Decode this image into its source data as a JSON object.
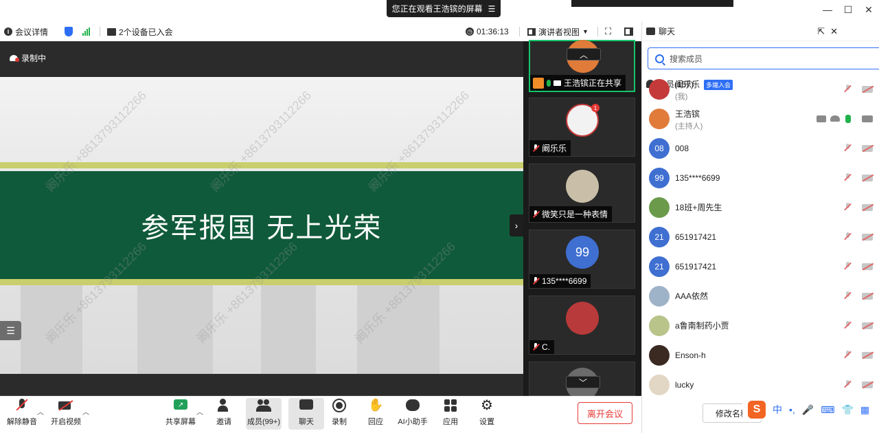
{
  "titlebar": {
    "share_notice": "您正在观看王浩镔的屏幕",
    "share_menu_icon": "menu-icon",
    "window_controls": [
      "—",
      "☐",
      "✕"
    ]
  },
  "infobar": {
    "meeting_info": "会议详情",
    "devices": "2个设备已入会",
    "duration": "01:36:13",
    "view_mode": "演讲者视图"
  },
  "stage": {
    "recording_label": "录制中",
    "slide_title": "参军报国  无上光荣",
    "watermarks": [
      "阚乐乐 +8613793112266",
      "阚乐乐 +8613793112266",
      "阚乐乐 +8613793112266",
      "阚乐乐 +8613793112266",
      "阚乐乐 +8613793112266",
      "阚乐乐 +8613793112266"
    ],
    "next_arrow": "›",
    "list_icon": "☰"
  },
  "thumbnails": [
    {
      "name": "王浩镔正在共享",
      "avatar_color": "#e07b3a",
      "active": true
    },
    {
      "name": "阚乐乐",
      "avatar_color": "#f2f2f2",
      "badge": "1"
    },
    {
      "name": "微笑只是一种表情",
      "avatar_color": "#c9bfa8"
    },
    {
      "name": "135****6699",
      "avatar_text": "99",
      "avatar_color": "#3f6fd1"
    },
    {
      "name": "C.",
      "avatar_color": "#b93a3a"
    },
    {
      "name": "",
      "avatar_color": "#6b6b6b"
    }
  ],
  "panel": {
    "tab_chat": "聊天",
    "tab_members": "成员(157)",
    "search_placeholder": "搜索成员",
    "members": [
      {
        "name": "阚乐乐",
        "sub": "(我)",
        "badge": "多端入会",
        "avatar_color": "#c43a3a",
        "mic": "off",
        "cam": "off"
      },
      {
        "name": "王浩镔",
        "sub": "(主持人)",
        "avatar_color": "#e07b3a",
        "mic": "on",
        "cam": "on",
        "extra": true
      },
      {
        "name": "008",
        "avatar_text": "08",
        "avatar_color": "#3f6fd1",
        "mic": "off",
        "cam": "off"
      },
      {
        "name": "135****6699",
        "avatar_text": "99",
        "avatar_color": "#3f6fd1",
        "mic": "off",
        "cam": "off"
      },
      {
        "name": "18班+周先生",
        "avatar_color": "#6b9b4a",
        "mic": "off",
        "cam": "off"
      },
      {
        "name": "651917421",
        "avatar_text": "21",
        "avatar_color": "#3f6fd1",
        "mic": "off",
        "cam": "off"
      },
      {
        "name": "651917421",
        "avatar_text": "21",
        "avatar_color": "#3f6fd1",
        "mic": "off",
        "cam": "off"
      },
      {
        "name": "AAA依然",
        "avatar_color": "#9fb3c8",
        "mic": "off",
        "cam": "off"
      },
      {
        "name": "a鲁南制药小贾",
        "avatar_color": "#b8c48a",
        "mic": "off",
        "cam": "off"
      },
      {
        "name": "Enson-h",
        "avatar_color": "#3a2a22",
        "mic": "off",
        "cam": "off"
      },
      {
        "name": "lucky",
        "avatar_color": "#e2d6c4",
        "mic": "off",
        "cam": "off"
      }
    ],
    "rename_button": "修改名称",
    "ime": {
      "logo": "S",
      "lang": "中",
      "punct": "•,",
      "mic": "🎤",
      "keyboard": "⌨",
      "shirt": "👕",
      "grid": "▦"
    }
  },
  "toolbar": {
    "unmute": "解除静音",
    "start_video": "开启视频",
    "share_screen": "共享屏幕",
    "invite": "邀请",
    "members": "成员(99+)",
    "chat": "聊天",
    "record": "录制",
    "reactions": "回应",
    "ai_assistant": "AI小助手",
    "apps": "应用",
    "settings": "设置",
    "leave": "离开会议"
  },
  "colors": {
    "accent": "#2d6ef5",
    "banner_green": "#0f5a3a",
    "stripe_yellow": "#c9cf6c",
    "active_border": "#16c56b",
    "danger": "#e53935"
  }
}
